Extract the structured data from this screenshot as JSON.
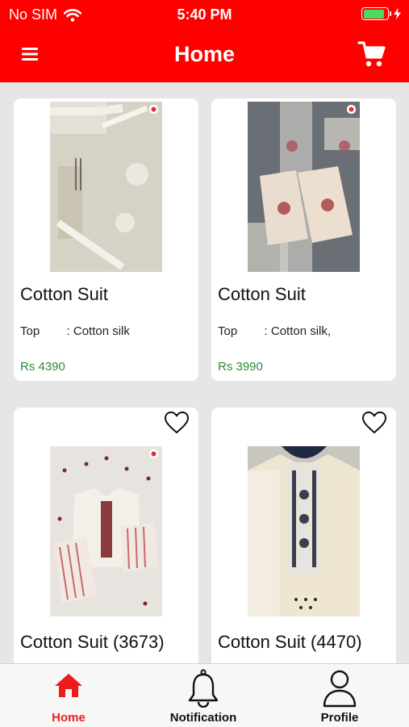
{
  "status_bar": {
    "carrier": "No SIM",
    "time": "5:40 PM",
    "battery_level": 0.9,
    "icons": [
      "wifi-icon",
      "battery-icon",
      "charging-bolt-icon"
    ]
  },
  "header": {
    "title": "Home",
    "menu_icon": "hamburger-menu-icon",
    "cart_icon": "shopping-cart-icon"
  },
  "products": [
    {
      "title": "Cotton Suit",
      "spec": "Top        : Cotton silk",
      "price": "Rs 4390",
      "image": "product-photo-beige-suit-lace"
    },
    {
      "title": "Cotton Suit",
      "spec": "Top        : Cotton silk,",
      "price": "Rs 3990",
      "image": "product-photo-grey-suit-embroidered"
    },
    {
      "title": "Cotton Suit (3673)",
      "image": "product-photo-white-suit-striped",
      "wishlist_icon": "heart-outline-icon"
    },
    {
      "title": "Cotton Suit (4470)",
      "image": "product-photo-cream-kurta-embroidered",
      "wishlist_icon": "heart-outline-icon"
    }
  ],
  "tabs": [
    {
      "label": "Home",
      "icon": "home-icon",
      "active": true
    },
    {
      "label": "Notification",
      "icon": "bell-icon",
      "active": false
    },
    {
      "label": "Profile",
      "icon": "person-icon",
      "active": false
    }
  ],
  "colors": {
    "brand_red": "#ff0000",
    "active_tab": "#ee1b1b",
    "price_green": "#2e8b35",
    "background": "#e6e6e6"
  }
}
